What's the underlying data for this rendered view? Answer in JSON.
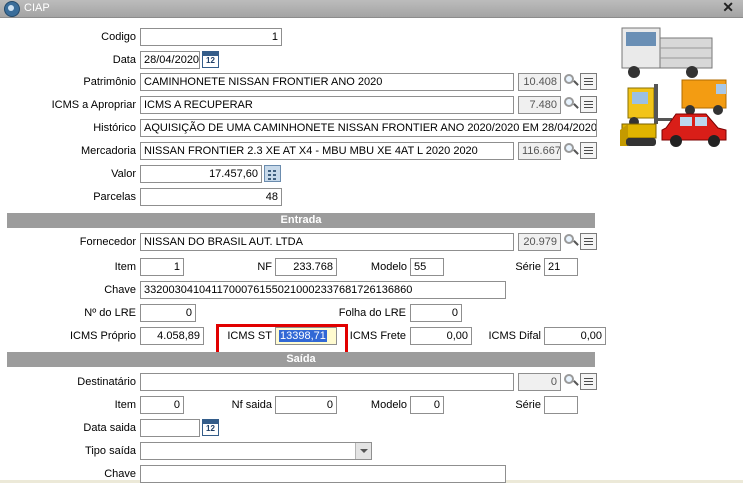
{
  "window": {
    "title": "CIAP",
    "close": "✕"
  },
  "fields": {
    "codigo": {
      "label": "Codigo",
      "value": "1"
    },
    "data": {
      "label": "Data",
      "value": "28/04/2020"
    },
    "patrimonio": {
      "label": "Patrimônio",
      "value": "CAMINHONETE NISSAN FRONTIER ANO 2020",
      "code": "10.408"
    },
    "icms_apropriar": {
      "label": "ICMS a Apropriar",
      "value": "ICMS A RECUPERAR",
      "code": "7.480"
    },
    "historico": {
      "label": "Histórico",
      "value": "AQUISIÇÃO DE UMA CAMINHONETE NISSAN FRONTIER ANO 2020/2020 EM 28/04/2020."
    },
    "mercadoria": {
      "label": "Mercadoria",
      "value": "NISSAN FRONTIER 2.3 XE AT X4 - MBU MBU XE 4AT L 2020 2020",
      "code": "116.667"
    },
    "valor": {
      "label": "Valor",
      "value": "17.457,60"
    },
    "parcelas": {
      "label": "Parcelas",
      "value": "48"
    }
  },
  "entrada": {
    "title": "Entrada",
    "fornecedor": {
      "label": "Fornecedor",
      "value": "NISSAN DO BRASIL AUT. LTDA",
      "code": "20.979"
    },
    "item": {
      "label": "Item",
      "value": "1"
    },
    "nf": {
      "label": "NF",
      "value": "233.768"
    },
    "modelo": {
      "label": "Modelo",
      "value": "55"
    },
    "serie": {
      "label": "Série",
      "value": "21"
    },
    "chave": {
      "label": "Chave",
      "value": "33200304104117000761550210002337681726136860"
    },
    "no_lre": {
      "label": "Nº do LRE",
      "value": "0"
    },
    "folha_lre": {
      "label": "Folha do LRE",
      "value": "0"
    },
    "icms_proprio": {
      "label": "ICMS Próprio",
      "value": "4.058,89"
    },
    "icms_st": {
      "label": "ICMS ST",
      "value": "13398,71"
    },
    "icms_frete": {
      "label": "ICMS Frete",
      "value": "0,00"
    },
    "icms_difal": {
      "label": "ICMS Difal",
      "value": "0,00"
    }
  },
  "saida": {
    "title": "Saída",
    "destinatario": {
      "label": "Destinatário",
      "value": "",
      "code": "0"
    },
    "item": {
      "label": "Item",
      "value": "0"
    },
    "nf_saida": {
      "label": "Nf saida",
      "value": "0"
    },
    "modelo": {
      "label": "Modelo",
      "value": "0"
    },
    "serie": {
      "label": "Série",
      "value": ""
    },
    "data_saida": {
      "label": "Data saida",
      "value": ""
    },
    "tipo_saida": {
      "label": "Tipo saída",
      "value": ""
    },
    "chave": {
      "label": "Chave",
      "value": ""
    }
  },
  "calendar_icon_text": "12",
  "colors": {
    "highlight": "#e10000",
    "selection": "#3168d5",
    "section": "#9c9c9c"
  }
}
